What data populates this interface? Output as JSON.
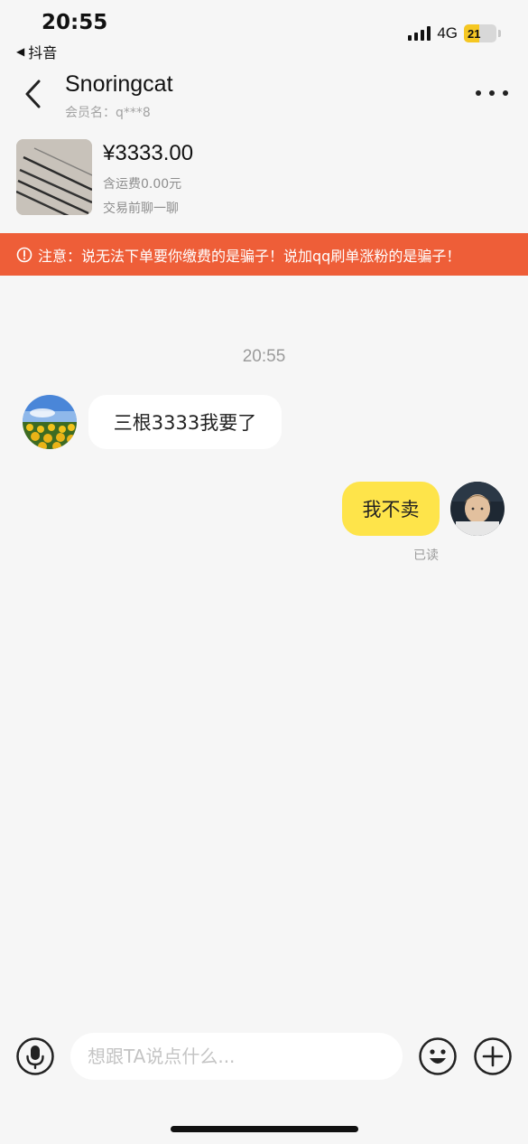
{
  "status_bar": {
    "time": "20:55",
    "back_app": "抖音",
    "network": "4G",
    "battery_level": "21",
    "battery_fraction": 0.21,
    "battery_color": "#f5c722"
  },
  "header": {
    "contact_name": "Snoringcat",
    "member_name": "会员名：q***8",
    "back_icon": "chevron-left-icon",
    "more_icon": "more-dots-icon"
  },
  "product": {
    "price": "¥3333.00",
    "shipping": "含运费0.00元",
    "note": "交易前聊一聊"
  },
  "warning": {
    "icon": "exclamation-circle-icon",
    "text": "注意：说无法下单要你缴费的是骗子！说加qq刷单涨粉的是骗子！",
    "color": "#ee5e38"
  },
  "chat": {
    "timestamp": "20:55",
    "messages": [
      {
        "from": "them",
        "text": "三根3333我要了"
      },
      {
        "from": "me",
        "text": "我不卖",
        "status": "已读"
      }
    ],
    "my_bubble_color": "#fee44a"
  },
  "input_bar": {
    "placeholder": "想跟TA说点什么...",
    "voice_icon": "microphone-icon",
    "emoji_icon": "emoji-icon",
    "plus_icon": "plus-icon"
  }
}
